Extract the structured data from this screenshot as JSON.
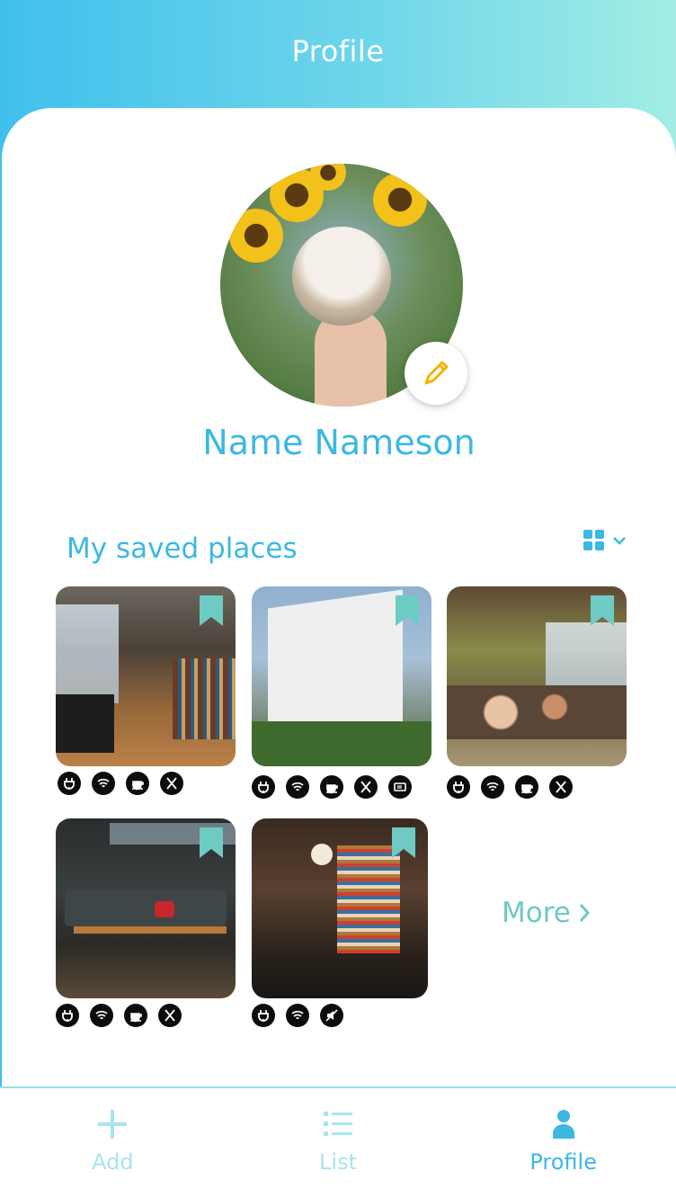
{
  "header": {
    "title": "Profile"
  },
  "profile": {
    "name": "Name Nameson",
    "edit_icon": "pencil-icon"
  },
  "saved": {
    "title": "My saved places",
    "view_toggle_icon": "grid-icon",
    "more_label": "More",
    "places": [
      {
        "image": "library-interior",
        "amenities": [
          "plug-icon",
          "wifi-icon",
          "coffee-icon",
          "food-icon"
        ]
      },
      {
        "image": "white-building-exterior",
        "amenities": [
          "plug-icon",
          "wifi-icon",
          "coffee-icon",
          "food-icon",
          "microwave-icon"
        ]
      },
      {
        "image": "cafe-dining-room",
        "amenities": [
          "plug-icon",
          "wifi-icon",
          "coffee-icon",
          "food-icon"
        ]
      },
      {
        "image": "dark-lounge",
        "amenities": [
          "plug-icon",
          "wifi-icon",
          "coffee-icon",
          "food-icon"
        ]
      },
      {
        "image": "bookshelf-cafe",
        "amenities": [
          "plug-icon",
          "wifi-icon",
          "quiet-icon"
        ]
      }
    ]
  },
  "tabs": [
    {
      "label": "Add",
      "icon": "plus-icon",
      "active": false
    },
    {
      "label": "List",
      "icon": "list-icon",
      "active": false
    },
    {
      "label": "Profile",
      "icon": "person-icon",
      "active": true
    }
  ],
  "colors": {
    "accent": "#3cb8e3",
    "teal": "#6dcbc3",
    "dim": "#a9e4ef"
  }
}
